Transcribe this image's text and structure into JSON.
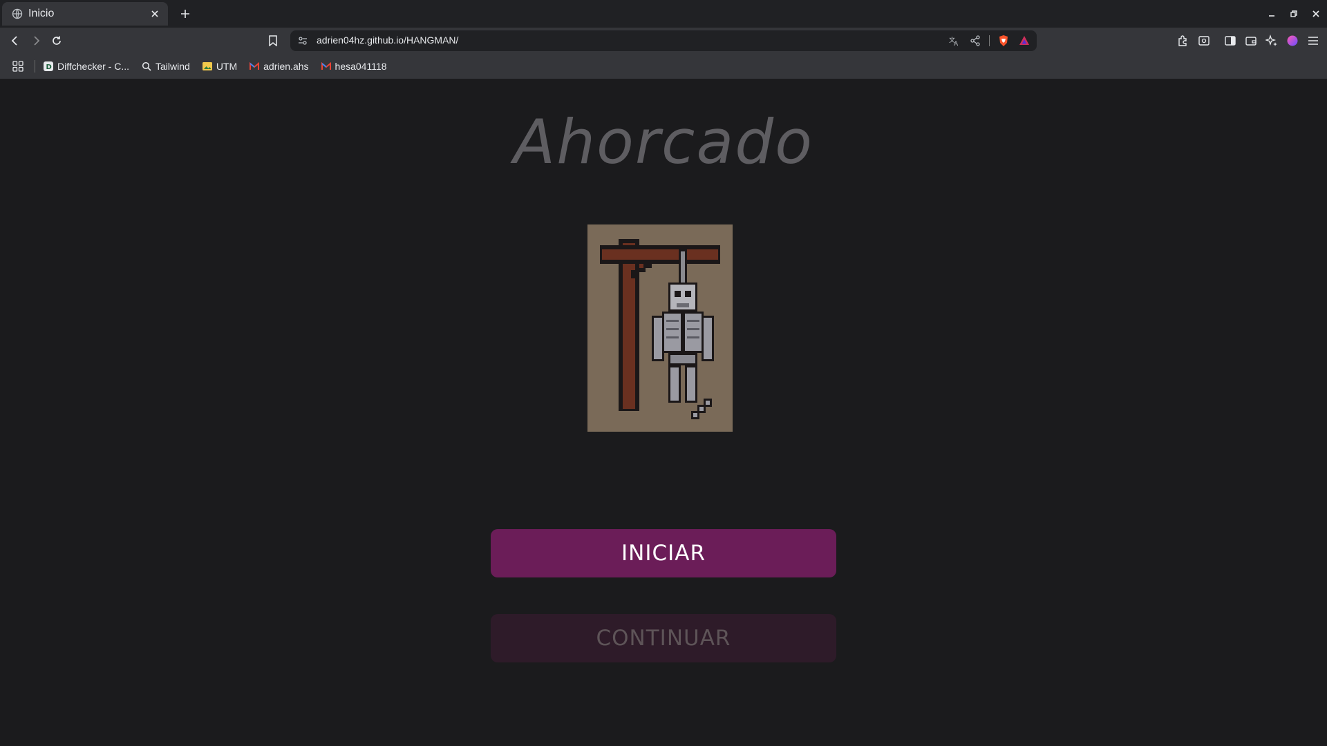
{
  "browser": {
    "tab_title": "Inicio",
    "url": "adrien04hz.github.io/HANGMAN/",
    "bookmarks": [
      {
        "label": "Diffchecker - C...",
        "icon": "diffchecker-icon"
      },
      {
        "label": "Tailwind",
        "icon": "search-icon"
      },
      {
        "label": "UTM",
        "icon": "image-icon"
      },
      {
        "label": "adrien.ahs",
        "icon": "gmail-icon"
      },
      {
        "label": "hesa041118",
        "icon": "gmail-icon"
      }
    ]
  },
  "page": {
    "title": "Ahorcado",
    "start_button": "INICIAR",
    "continue_button": "CONTINUAR"
  },
  "colors": {
    "background": "#1b1b1d",
    "title": "#5e5d61",
    "start_button": "#6b1d58",
    "continue_button": "#2e1b29",
    "art_background": "#7a6a58"
  }
}
